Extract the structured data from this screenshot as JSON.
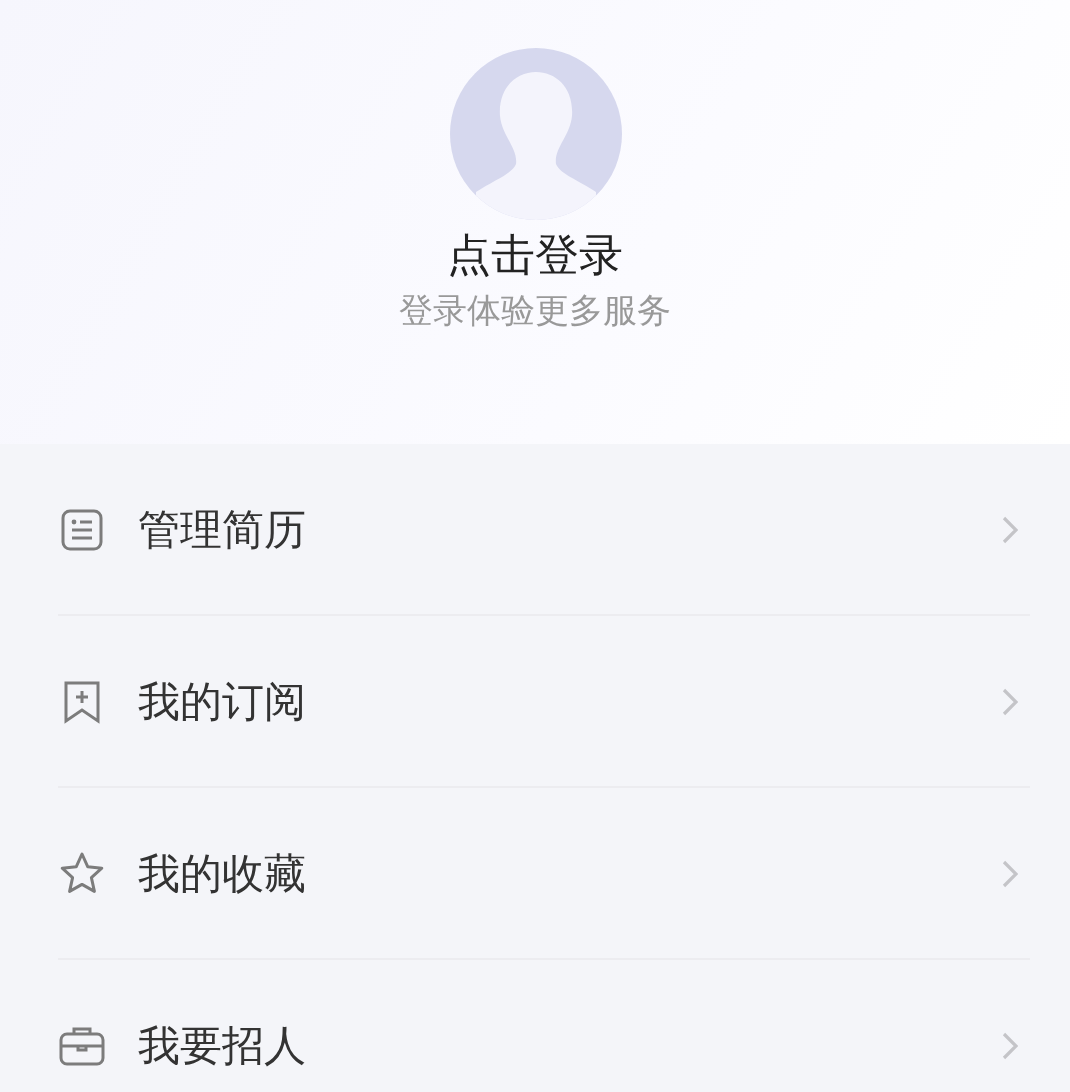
{
  "profile": {
    "title": "点击登录",
    "subtitle": "登录体验更多服务"
  },
  "menu": [
    {
      "kind": "resume",
      "label": "管理简历"
    },
    {
      "kind": "bookmark",
      "label": "我的订阅"
    },
    {
      "kind": "star",
      "label": "我的收藏"
    },
    {
      "kind": "briefcase",
      "label": "我要招人"
    }
  ]
}
